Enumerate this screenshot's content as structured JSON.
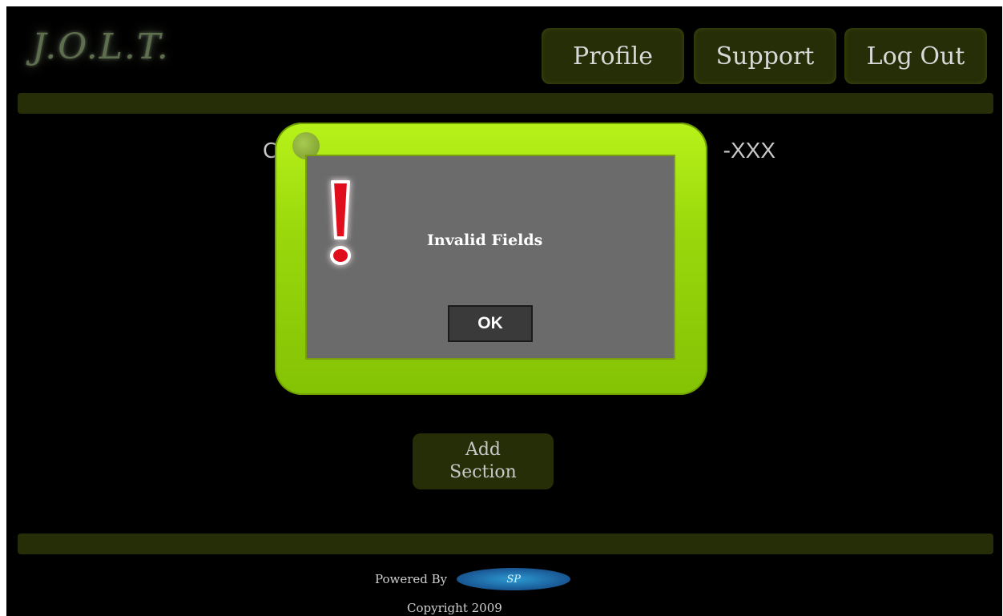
{
  "header": {
    "logo_text": "J.O.L.T.",
    "nav": {
      "profile": "Profile",
      "support": "Support",
      "logout": "Log Out"
    }
  },
  "main": {
    "course_prefix": "C",
    "course_suffix": "-XXX",
    "add_section_line1": "Add",
    "add_section_line2": "Section"
  },
  "dialog": {
    "message": "Invalid Fields",
    "ok_label": "OK",
    "icon": "exclamation-icon"
  },
  "footer": {
    "powered_by": "Powered By",
    "sponsor_logo_text": "SP",
    "copyright": "Copyright 2009"
  },
  "colors": {
    "background": "#000000",
    "nav_button": "#262e07",
    "modal_border": "#9ad80c",
    "modal_body": "#6b6b6b",
    "alert_red": "#e0101a"
  }
}
